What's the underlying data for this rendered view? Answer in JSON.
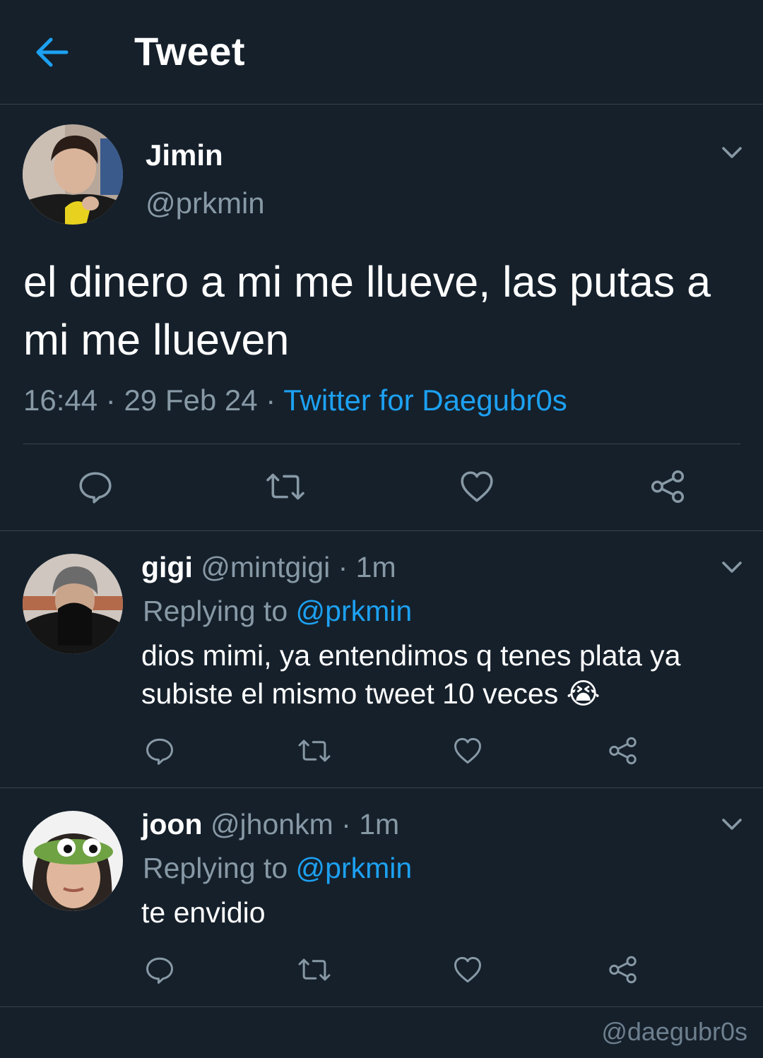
{
  "header": {
    "title": "Tweet",
    "back_icon": "arrow-left-icon"
  },
  "main_tweet": {
    "name": "Jimin",
    "handle": "@prkmin",
    "text": "el dinero a mi me llueve, las putas a mi me llueven",
    "time": "16:44",
    "date": "29 Feb 24",
    "source": "Twitter for Daegubr0s",
    "separator": "·"
  },
  "replies": [
    {
      "name": "gigi",
      "handle": "@mintgigi",
      "age": "1m",
      "replying_label": "Replying to",
      "replying_to": "@prkmin",
      "text": "dios mimi, ya entendimos q tenes plata ya subiste el mismo tweet 10 veces 😭"
    },
    {
      "name": "joon",
      "handle": "@jhonkm",
      "age": "1m",
      "replying_label": "Replying to",
      "replying_to": "@prkmin",
      "text": "te envidio"
    }
  ],
  "watermark": "@daegubr0s",
  "colors": {
    "background": "#15202b",
    "accent": "#1da1f2",
    "secondary_text": "#8899a6",
    "border": "#38444d"
  },
  "icons": [
    "arrow-left-icon",
    "chevron-down-icon",
    "reply-icon",
    "retweet-icon",
    "heart-icon",
    "share-icon"
  ]
}
